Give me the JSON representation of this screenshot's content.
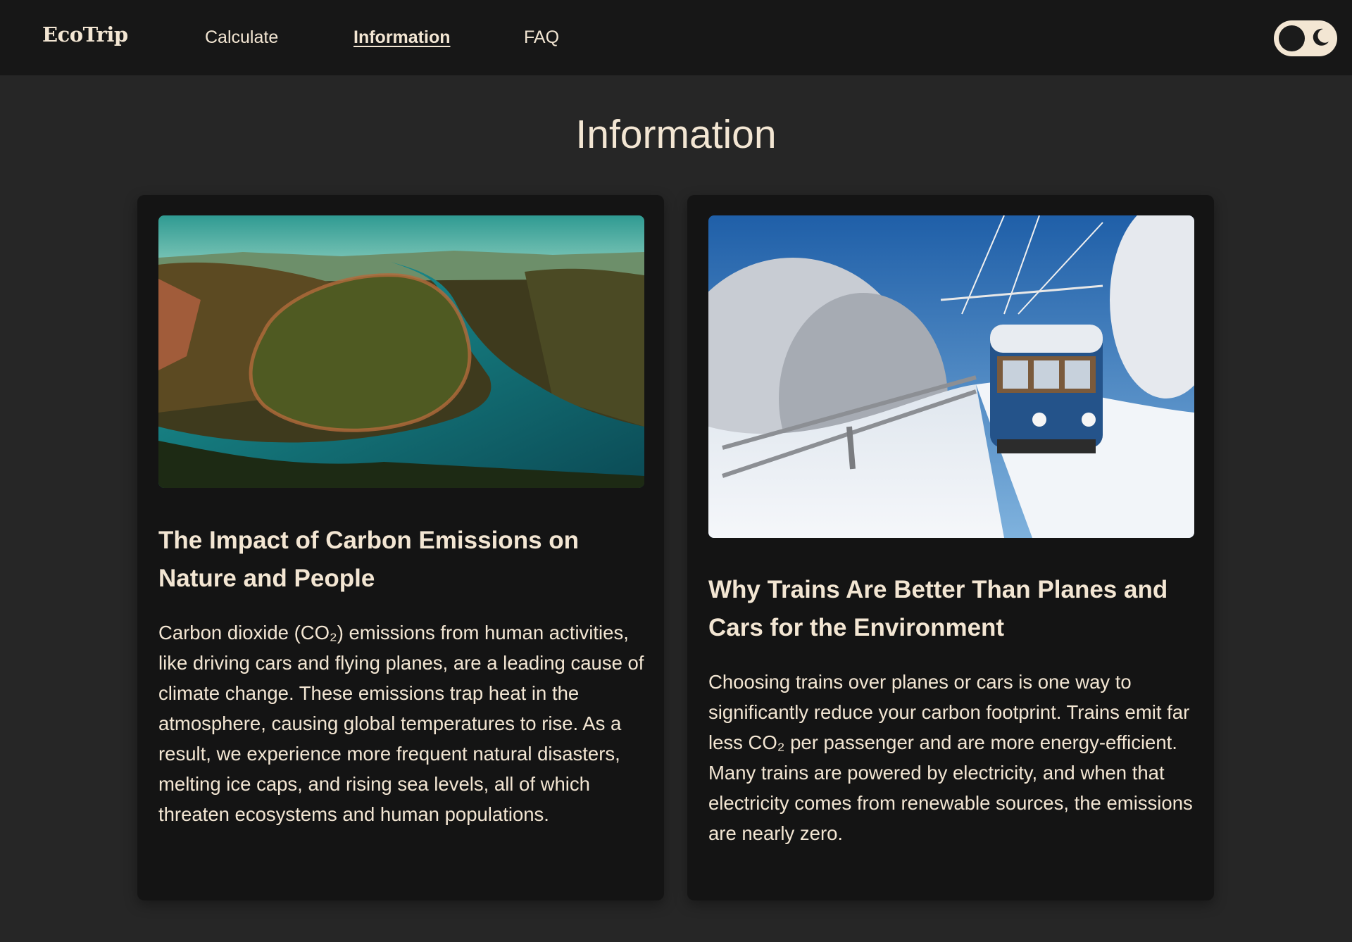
{
  "nav": {
    "brand": "EcoTrip",
    "links": [
      {
        "label": "Calculate"
      },
      {
        "label": "Information"
      },
      {
        "label": "FAQ"
      }
    ],
    "active": "Information"
  },
  "theme_toggle": {
    "icons": [
      "toggle-knob",
      "moon-icon"
    ]
  },
  "page": {
    "title": "Information"
  },
  "cards": [
    {
      "image_subject": "river-bend-forest-photo",
      "title": "The Impact of Carbon Emissions on Nature and People",
      "body": "Carbon dioxide (CO₂) emissions from human activities, like driving cars and flying planes, are a leading cause of climate change. These emissions trap heat in the atmosphere, causing global temperatures to rise. As a result, we experience more frequent natural disasters, melting ice caps, and rising sea levels, all of which threaten ecosystems and human populations."
    },
    {
      "image_subject": "snowy-train-photo",
      "title": "Why Trains Are Better Than Planes and Cars for the Environment",
      "body": "Choosing trains over planes or cars is one way to significantly reduce your carbon footprint. Trains emit far less CO₂ per passenger and are more energy-efficient. Many trains are powered by electricity, and when that electricity comes from renewable sources, the emissions are nearly zero."
    }
  ],
  "colors": {
    "page_background": "#262626",
    "nav_background": "#171717",
    "card_background": "#141414",
    "text": "#f3e6d3"
  }
}
